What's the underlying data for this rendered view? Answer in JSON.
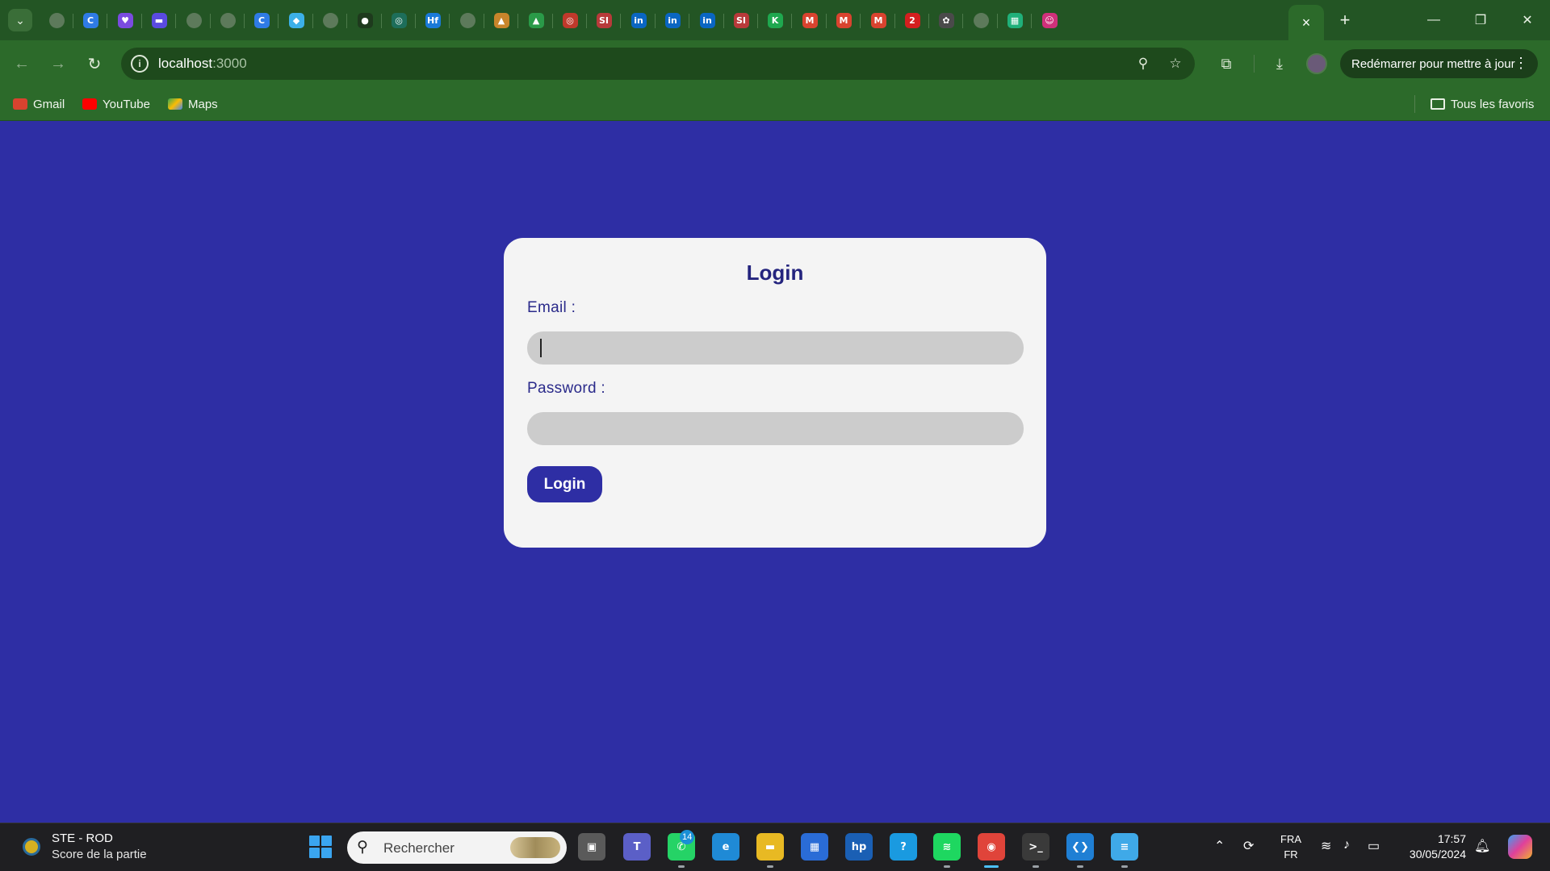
{
  "browser": {
    "tabs": [
      {
        "icon": "globe-icon",
        "glyph": "",
        "color": "#5d7a5b"
      },
      {
        "icon": "c-app-icon",
        "glyph": "C",
        "color": "#2f7be5"
      },
      {
        "icon": "shield-app-icon",
        "glyph": "♥",
        "color": "#7b4be0"
      },
      {
        "icon": "printer-app-icon",
        "glyph": "▬",
        "color": "#5a4ae0"
      },
      {
        "icon": "globe-icon",
        "glyph": "",
        "color": "#5d7a5b"
      },
      {
        "icon": "globe-icon",
        "glyph": "",
        "color": "#5d7a5b"
      },
      {
        "icon": "c-app-icon",
        "glyph": "C",
        "color": "#2f7be5"
      },
      {
        "icon": "diamond-app-icon",
        "glyph": "◆",
        "color": "#3cb0e8"
      },
      {
        "icon": "globe-icon",
        "glyph": "",
        "color": "#5d7a5b"
      },
      {
        "icon": "github-icon",
        "glyph": "●",
        "color": "#1e3a1d"
      },
      {
        "icon": "circle-app-icon",
        "glyph": "◎",
        "color": "#1d6e5a"
      },
      {
        "icon": "hf-app-icon",
        "glyph": "Hf",
        "color": "#1a7ad8"
      },
      {
        "icon": "globe-icon",
        "glyph": "",
        "color": "#5d7a5b"
      },
      {
        "icon": "mountain-app-icon",
        "glyph": "▲",
        "color": "#c8852b"
      },
      {
        "icon": "drive-icon",
        "glyph": "▲",
        "color": "#2a9a48"
      },
      {
        "icon": "target-app-icon",
        "glyph": "◎",
        "color": "#c0392b"
      },
      {
        "icon": "si-app-icon",
        "glyph": "SI",
        "color": "#b83a3a"
      },
      {
        "icon": "linkedin-icon",
        "glyph": "in",
        "color": "#0a66c2"
      },
      {
        "icon": "linkedin-icon",
        "glyph": "in",
        "color": "#0a66c2"
      },
      {
        "icon": "linkedin-icon",
        "glyph": "in",
        "color": "#0a66c2"
      },
      {
        "icon": "si-app-icon",
        "glyph": "SI",
        "color": "#b83a3a"
      },
      {
        "icon": "k-app-icon",
        "glyph": "K",
        "color": "#1fa84f"
      },
      {
        "icon": "gmail-icon",
        "glyph": "M",
        "color": "#d9432f"
      },
      {
        "icon": "gmail-icon",
        "glyph": "M",
        "color": "#d9432f"
      },
      {
        "icon": "gmail-icon",
        "glyph": "M",
        "color": "#d9432f"
      },
      {
        "icon": "two-app-icon",
        "glyph": "2",
        "color": "#d41f1f"
      },
      {
        "icon": "openai-icon",
        "glyph": "✿",
        "color": "#4a4a4a"
      },
      {
        "icon": "globe-icon",
        "glyph": "",
        "color": "#5d7a5b"
      },
      {
        "icon": "sheet-app-icon",
        "glyph": "▦",
        "color": "#20b07a"
      },
      {
        "icon": "smile-app-icon",
        "glyph": "☺",
        "color": "#d0307a"
      }
    ],
    "active_tab_close": "×",
    "new_tab": "+",
    "window_controls": {
      "minimize": "—",
      "restore": "❐",
      "close": "✕"
    },
    "nav": {
      "back": "←",
      "forward": "→",
      "reload": "↻"
    },
    "url_host": "localhost",
    "url_port": ":3000",
    "restart_button": "Redémarrer pour mettre à jour",
    "bookmarks": [
      {
        "label": "Gmail",
        "color": "#d9432f"
      },
      {
        "label": "YouTube",
        "color": "#ff0000"
      },
      {
        "label": "Maps",
        "color": "#34a853"
      }
    ],
    "all_bookmarks": "Tous les favoris"
  },
  "form": {
    "title": "Login",
    "email_label": "Email :",
    "email_value": "",
    "password_label": "Password :",
    "password_value": "",
    "submit_label": "Login"
  },
  "taskbar": {
    "weather_title": "STE - ROD",
    "weather_subtitle": "Score de la partie",
    "search_placeholder": "Rechercher",
    "apps": [
      {
        "name": "task-view-icon",
        "glyph": "▣",
        "color": "#5a5a5a"
      },
      {
        "name": "teams-icon",
        "glyph": "T",
        "color": "#5b5fc7"
      },
      {
        "name": "whatsapp-icon",
        "glyph": "✆",
        "color": "#25d366"
      },
      {
        "name": "edge-icon",
        "glyph": "e",
        "color": "#1f8ad6"
      },
      {
        "name": "file-explorer-icon",
        "glyph": "▬",
        "color": "#e8b923"
      },
      {
        "name": "microsoft-store-icon",
        "glyph": "▦",
        "color": "#2a6cd6"
      },
      {
        "name": "myhp-icon",
        "glyph": "hp",
        "color": "#1a5fb4"
      },
      {
        "name": "help-app-icon",
        "glyph": "?",
        "color": "#1a9ae0"
      },
      {
        "name": "spotify-icon",
        "glyph": "≋",
        "color": "#1ed760"
      },
      {
        "name": "chrome-icon",
        "glyph": "◉",
        "color": "#e0443a"
      },
      {
        "name": "terminal-icon",
        "glyph": ">_",
        "color": "#3a3a3a"
      },
      {
        "name": "vscode-icon",
        "glyph": "❮❯",
        "color": "#1f7fd4"
      },
      {
        "name": "notepad-icon",
        "glyph": "≡",
        "color": "#3fa9e8"
      }
    ],
    "whatsapp_badge": "14",
    "lang_top": "FRA",
    "lang_bottom": "FR",
    "time": "17:57",
    "date": "30/05/2024"
  }
}
